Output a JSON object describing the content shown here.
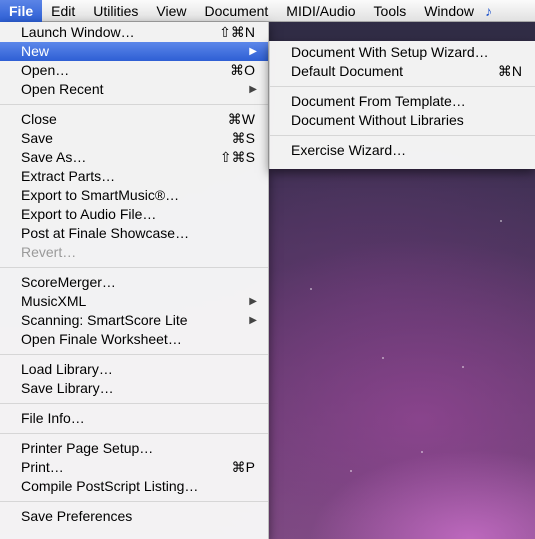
{
  "menubar": {
    "items": [
      "File",
      "Edit",
      "Utilities",
      "View",
      "Document",
      "MIDI/Audio",
      "Tools",
      "Window"
    ],
    "extra_glyph": "♪"
  },
  "file_menu": {
    "groups": [
      [
        {
          "label": "Launch Window…",
          "shortcut": "⇧⌘N"
        },
        {
          "label": "New",
          "submenu": true,
          "highlighted": true
        },
        {
          "label": "Open…",
          "shortcut": "⌘O"
        },
        {
          "label": "Open Recent",
          "submenu": true
        }
      ],
      [
        {
          "label": "Close",
          "shortcut": "⌘W"
        },
        {
          "label": "Save",
          "shortcut": "⌘S"
        },
        {
          "label": "Save As…",
          "shortcut": "⇧⌘S"
        },
        {
          "label": "Extract Parts…"
        },
        {
          "label": "Export to SmartMusic®…"
        },
        {
          "label": "Export to Audio File…"
        },
        {
          "label": "Post at Finale Showcase…"
        },
        {
          "label": "Revert…",
          "disabled": true
        }
      ],
      [
        {
          "label": "ScoreMerger…"
        },
        {
          "label": "MusicXML",
          "submenu": true
        },
        {
          "label": "Scanning: SmartScore Lite",
          "submenu": true
        },
        {
          "label": "Open Finale Worksheet…"
        }
      ],
      [
        {
          "label": "Load Library…"
        },
        {
          "label": "Save Library…"
        }
      ],
      [
        {
          "label": "File Info…"
        }
      ],
      [
        {
          "label": "Printer Page Setup…"
        },
        {
          "label": "Print…",
          "shortcut": "⌘P"
        },
        {
          "label": "Compile PostScript Listing…"
        }
      ],
      [
        {
          "label": "Save Preferences"
        }
      ]
    ]
  },
  "new_submenu": {
    "groups": [
      [
        {
          "label": "Document With Setup Wizard…"
        },
        {
          "label": "Default Document",
          "shortcut": "⌘N"
        }
      ],
      [
        {
          "label": "Document From Template…"
        },
        {
          "label": "Document Without Libraries"
        }
      ],
      [
        {
          "label": "Exercise Wizard…"
        }
      ]
    ]
  },
  "colors": {
    "highlight": "#2e5fd4",
    "disabled_text": "#9a9a9a"
  }
}
